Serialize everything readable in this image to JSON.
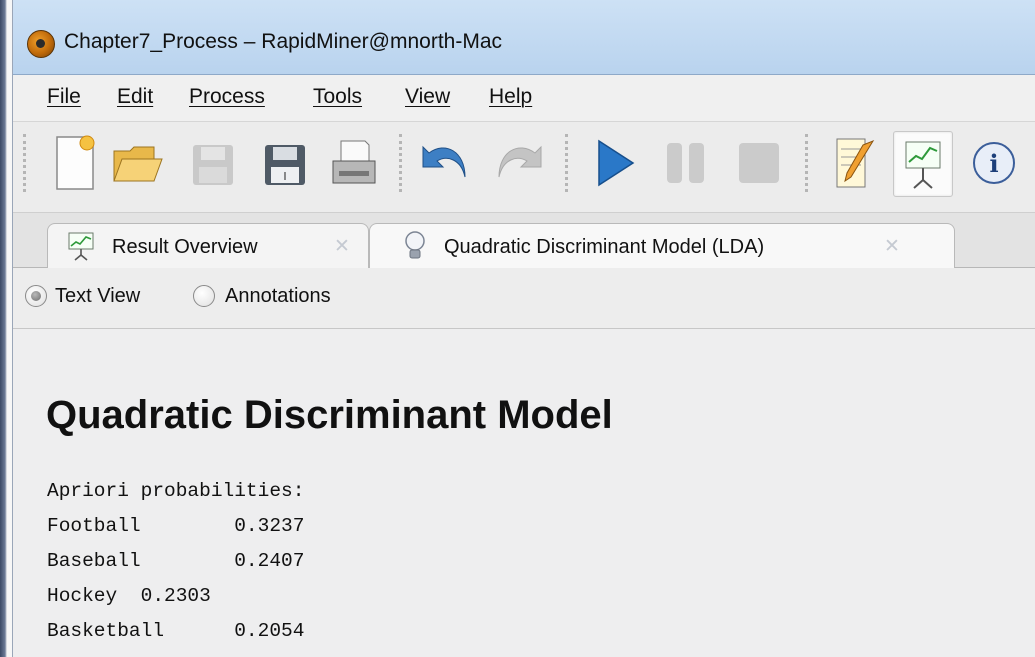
{
  "window": {
    "title": "Chapter7_Process – RapidMiner@mnorth-Mac",
    "app_icon": "rapidminer-logo-icon"
  },
  "menu": {
    "items": [
      "File",
      "Edit",
      "Process",
      "Tools",
      "View",
      "Help"
    ]
  },
  "toolbar": {
    "buttons": [
      {
        "name": "new-process-icon",
        "enabled": true
      },
      {
        "name": "open-folder-icon",
        "enabled": true
      },
      {
        "name": "save-icon",
        "enabled": false
      },
      {
        "name": "save-as-icon",
        "enabled": true
      },
      {
        "name": "print-icon",
        "enabled": true
      },
      {
        "name": "undo-icon",
        "enabled": true
      },
      {
        "name": "redo-icon",
        "enabled": false
      },
      {
        "name": "run-icon",
        "enabled": true
      },
      {
        "name": "pause-icon",
        "enabled": false
      },
      {
        "name": "stop-icon",
        "enabled": false
      },
      {
        "name": "design-perspective-icon",
        "enabled": true
      },
      {
        "name": "result-perspective-icon",
        "enabled": true,
        "active": true
      },
      {
        "name": "info-icon",
        "enabled": true
      }
    ]
  },
  "tabs": [
    {
      "label": "Result Overview",
      "icon": "chart-presentation-icon"
    },
    {
      "label": "Quadratic Discriminant Model (LDA)",
      "icon": "lightbulb-icon",
      "selected": true
    }
  ],
  "view_options": {
    "text_view": "Text View",
    "annotations": "Annotations",
    "selected": "text_view"
  },
  "content": {
    "heading": "Quadratic Discriminant Model",
    "lines": [
      "Apriori probabilities:",
      "Football        0.3237",
      "Baseball        0.2407",
      "Hockey  0.2303",
      "Basketball      0.2054"
    ]
  },
  "colors": {
    "titlebar": "#c4dbf2",
    "run_blue": "#2a78c8",
    "undo_blue": "#3d7fc4"
  }
}
